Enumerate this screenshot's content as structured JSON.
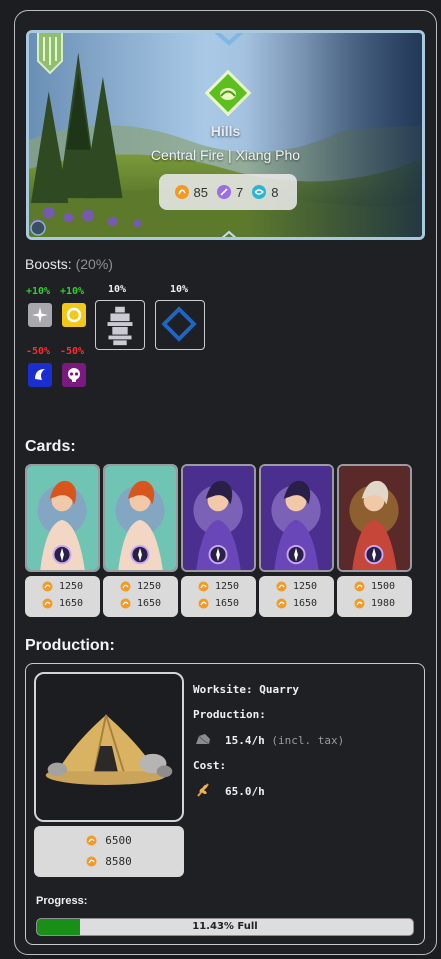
{
  "region": {
    "terrain": "Hills",
    "subtitle": "Central Fire | Xiang Pho",
    "stats": [
      {
        "icon": "power-icon",
        "value": "85"
      },
      {
        "icon": "magic-icon",
        "value": "7"
      },
      {
        "icon": "speed-icon",
        "value": "8"
      }
    ]
  },
  "boosts": {
    "label": "Boosts:",
    "total": "(20%)",
    "small_top": [
      {
        "pct": "+10%",
        "icon": "neutral-element-icon",
        "color": "green"
      },
      {
        "pct": "+10%",
        "icon": "life-element-icon",
        "color": "green"
      }
    ],
    "small_bottom": [
      {
        "pct": "-50%",
        "icon": "water-element-icon",
        "color": "red"
      },
      {
        "pct": "-50%",
        "icon": "death-element-icon",
        "color": "red"
      }
    ],
    "large": [
      {
        "pct": "10%",
        "icon": "totem-icon"
      },
      {
        "pct": "10%",
        "icon": "rune-diamond-icon"
      }
    ]
  },
  "cards_section": {
    "title": "Cards:",
    "cards": [
      {
        "name": "fire-mage-card",
        "base": "1250",
        "boosted": "1650"
      },
      {
        "name": "fire-mage-card",
        "base": "1250",
        "boosted": "1650"
      },
      {
        "name": "dark-sorcerer-card",
        "base": "1250",
        "boosted": "1650"
      },
      {
        "name": "dark-sorcerer-card",
        "base": "1250",
        "boosted": "1650"
      },
      {
        "name": "dragon-card",
        "base": "1500",
        "boosted": "1980"
      }
    ]
  },
  "production": {
    "title": "Production:",
    "worksite_label": "Worksite: Quarry",
    "production_label": "Production:",
    "production_value": "15.4/h",
    "production_note": "(incl. tax)",
    "cost_label": "Cost:",
    "cost_value": "65.0/h",
    "worksite_base": "6500",
    "worksite_boosted": "8580",
    "progress_label": "Progress:",
    "progress_text": "11.43% Full",
    "progress_fraction": 0.1143
  },
  "colors": {
    "boost_positive": "#2fd02f",
    "boost_negative": "#ff2b2b",
    "progress_fill": "#1a8f18",
    "terrain_badge": "#5cbf1f"
  }
}
